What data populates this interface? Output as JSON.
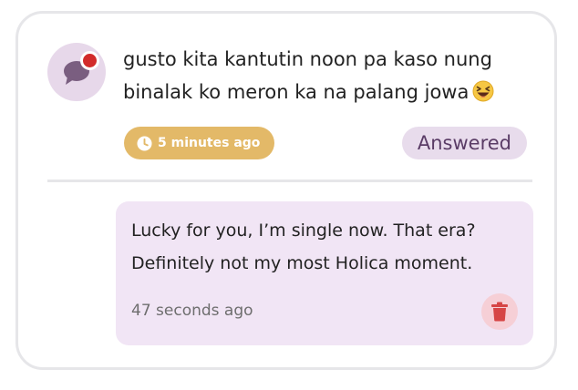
{
  "question": {
    "text": "gusto kita kantutin noon pa kaso nung binalak ko meron ka na palang jowa",
    "emoji": "laughing-squinting-face",
    "time_label": "5 minutes ago",
    "status_label": "Answered",
    "avatar_icon": "chat-bubble-icon",
    "notification_color": "#d22b2b"
  },
  "answer": {
    "text": "Lucky for you, I’m single now. That era? Definitely not my most Holica moment.",
    "time_label": "47 seconds ago",
    "delete_icon": "trash-icon"
  },
  "colors": {
    "time_badge": "#e3b968",
    "status_badge_bg": "#e8dcec",
    "status_badge_text": "#5a3c66",
    "answer_bg": "#f1e5f5",
    "delete_bg": "#f6cfd6",
    "delete_icon": "#d64545",
    "avatar_bg": "#e7d8ea",
    "chat_icon": "#7a5e80"
  }
}
